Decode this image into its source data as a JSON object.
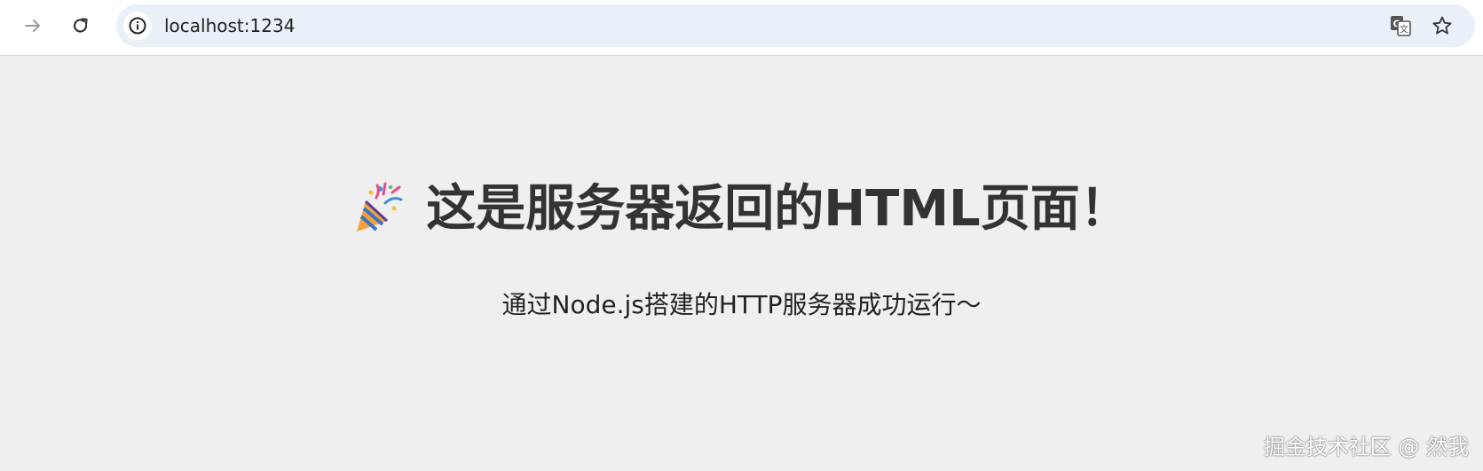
{
  "browser": {
    "url": "localhost:1234",
    "icons": {
      "forward": "arrow-right-icon",
      "reload": "reload-icon",
      "site_info": "info-icon",
      "translate": "translate-icon",
      "bookmark": "star-icon"
    }
  },
  "page": {
    "heading": "这是服务器返回的HTML页面！",
    "heading_icon": "party-popper-icon",
    "subtitle": "通过Node.js搭建的HTTP服务器成功运行～",
    "watermark": "掘金技术社区 @ 然我"
  },
  "colors": {
    "page_background": "#efefef",
    "heading": "#333333",
    "omnibox": "#eaf0f8"
  }
}
